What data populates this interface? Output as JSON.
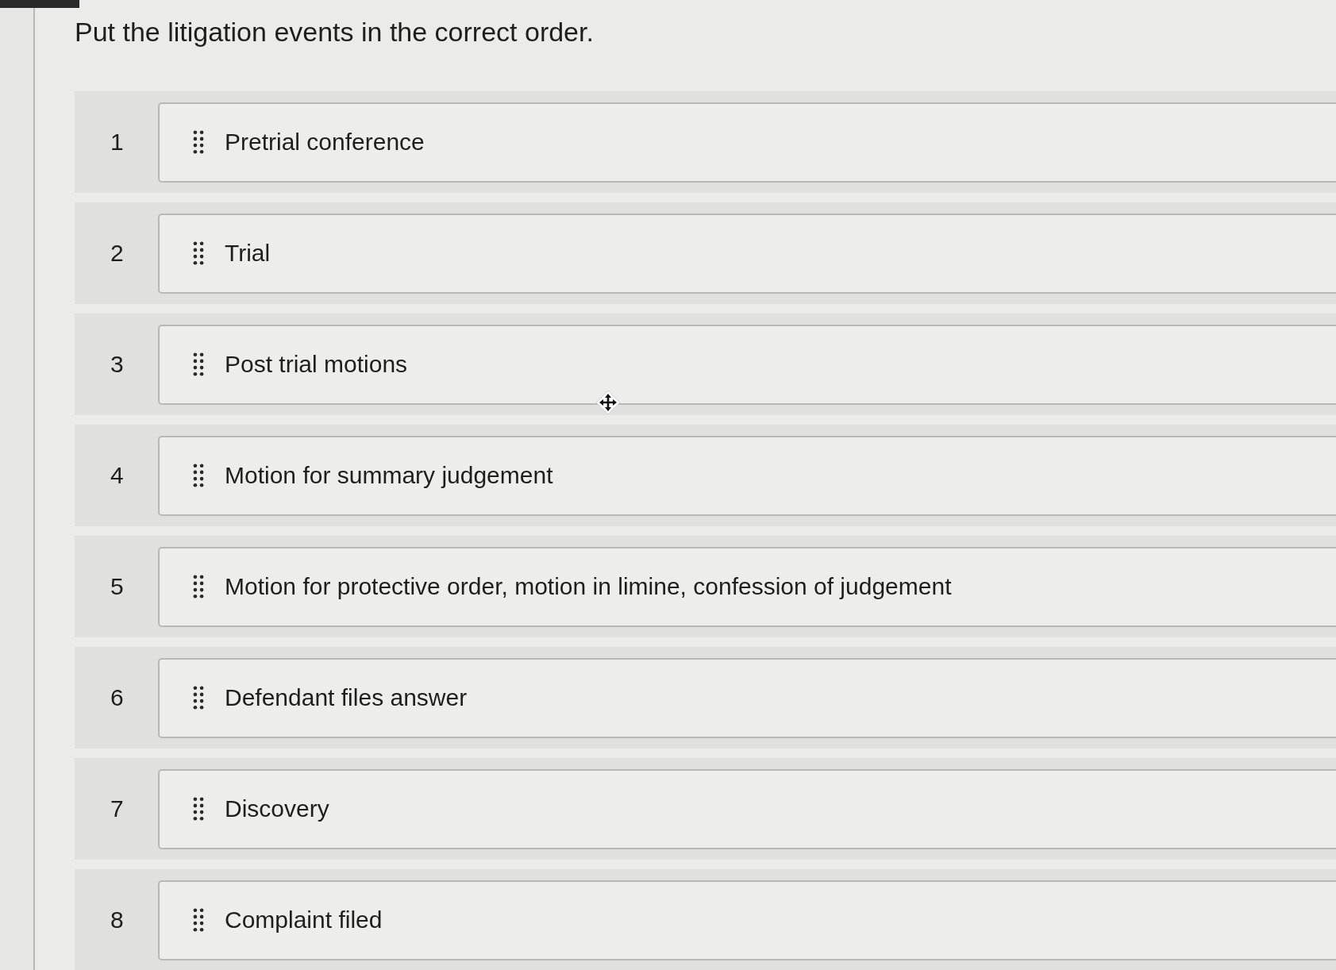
{
  "question": "Put the litigation events in the correct order.",
  "items": [
    {
      "number": "1",
      "label": "Pretrial conference"
    },
    {
      "number": "2",
      "label": "Trial"
    },
    {
      "number": "3",
      "label": "Post trial motions"
    },
    {
      "number": "4",
      "label": "Motion for summary judgement"
    },
    {
      "number": "5",
      "label": "Motion for protective order, motion in limine, confession of judgement"
    },
    {
      "number": "6",
      "label": "Defendant files answer"
    },
    {
      "number": "7",
      "label": "Discovery"
    },
    {
      "number": "8",
      "label": "Complaint filed"
    }
  ]
}
